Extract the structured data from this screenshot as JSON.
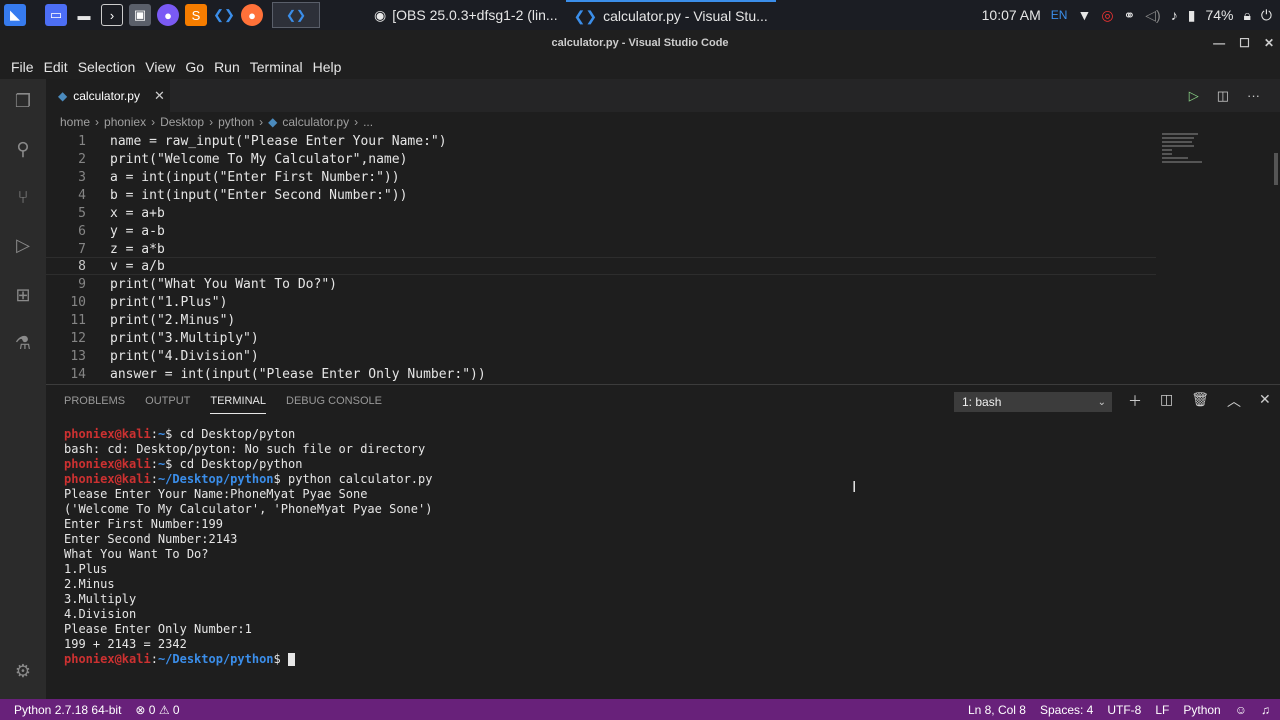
{
  "taskbar": {
    "windows": [
      {
        "label": "[OBS 25.0.3+dfsg1-2 (lin...",
        "active": false
      },
      {
        "label": "calculator.py - Visual Stu...",
        "active": true
      }
    ],
    "time": "10:07 AM",
    "lang": "EN",
    "battery": "74%"
  },
  "titlebar": {
    "title": "calculator.py - Visual Studio Code"
  },
  "menu": [
    "File",
    "Edit",
    "Selection",
    "View",
    "Go",
    "Run",
    "Terminal",
    "Help"
  ],
  "tab": {
    "label": "calculator.py"
  },
  "breadcrumb": [
    "home",
    "phoniex",
    "Desktop",
    "python",
    "calculator.py",
    "..."
  ],
  "code_lines": [
    {
      "n": "1",
      "text": "name = raw_input(\"Please Enter Your Name:\")"
    },
    {
      "n": "2",
      "text": "print(\"Welcome To My Calculator\",name)"
    },
    {
      "n": "3",
      "text": "a = int(input(\"Enter First Number:\"))"
    },
    {
      "n": "4",
      "text": "b = int(input(\"Enter Second Number:\"))"
    },
    {
      "n": "5",
      "text": "x = a+b"
    },
    {
      "n": "6",
      "text": "y = a-b"
    },
    {
      "n": "7",
      "text": "z = a*b"
    },
    {
      "n": "8",
      "text": "v = a/b"
    },
    {
      "n": "9",
      "text": "print(\"What You Want To Do?\")"
    },
    {
      "n": "10",
      "text": "print(\"1.Plus\")"
    },
    {
      "n": "11",
      "text": "print(\"2.Minus\")"
    },
    {
      "n": "12",
      "text": "print(\"3.Multiply\")"
    },
    {
      "n": "13",
      "text": "print(\"4.Division\")"
    },
    {
      "n": "14",
      "text": "answer = int(input(\"Please Enter Only Number:\"))"
    }
  ],
  "panel": {
    "tabs": [
      "PROBLEMS",
      "OUTPUT",
      "TERMINAL",
      "DEBUG CONSOLE"
    ],
    "active_tab": "TERMINAL",
    "terminal_select": "1: bash"
  },
  "terminal": {
    "user": "phoniex@kali",
    "lines": [
      {
        "prompt": true,
        "path": "~",
        "cmd": " cd Desktop/pyton"
      },
      {
        "prompt": false,
        "text": "bash: cd: Desktop/pyton: No such file or directory"
      },
      {
        "prompt": true,
        "path": "~",
        "cmd": " cd Desktop/python"
      },
      {
        "prompt": true,
        "path": "~/Desktop/python",
        "cmd": " python calculator.py"
      },
      {
        "prompt": false,
        "text": "Please Enter Your Name:PhoneMyat Pyae Sone"
      },
      {
        "prompt": false,
        "text": "('Welcome To My Calculator', 'PhoneMyat Pyae Sone')"
      },
      {
        "prompt": false,
        "text": "Enter First Number:199"
      },
      {
        "prompt": false,
        "text": "Enter Second Number:2143"
      },
      {
        "prompt": false,
        "text": "What You Want To Do?"
      },
      {
        "prompt": false,
        "text": "1.Plus"
      },
      {
        "prompt": false,
        "text": "2.Minus"
      },
      {
        "prompt": false,
        "text": "3.Multiply"
      },
      {
        "prompt": false,
        "text": "4.Division"
      },
      {
        "prompt": false,
        "text": "Please Enter Only Number:1"
      },
      {
        "prompt": false,
        "text": "199 + 2143 = 2342"
      },
      {
        "prompt": true,
        "path": "~/Desktop/python",
        "cmd": " ",
        "cursor": true
      }
    ]
  },
  "statusbar": {
    "python": "Python 2.7.18 64-bit",
    "problems": "⊗ 0 ⚠ 0",
    "position": "Ln 8, Col 8",
    "spaces": "Spaces: 4",
    "encoding": "UTF-8",
    "eol": "LF",
    "language": "Python"
  },
  "colors": {
    "statusbar": "#68217a",
    "prompt_user": "#cd3131",
    "prompt_path": "#3b8eea"
  }
}
